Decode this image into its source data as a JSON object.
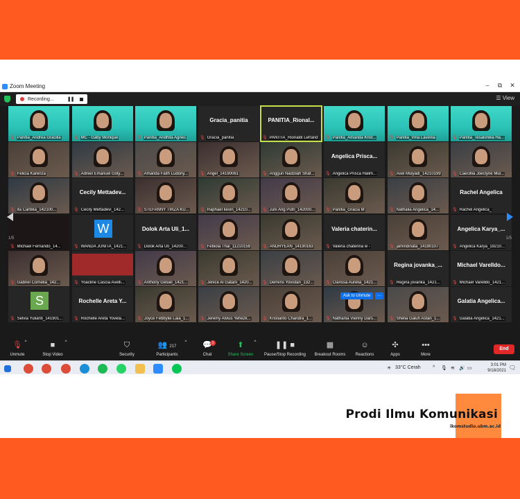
{
  "brand": {
    "title": "Prodi Ilmu Komunikasi",
    "url": "ikomstudio.ubm.ac.id"
  },
  "window": {
    "title": "Zoom Meeting",
    "minimize": "–",
    "maximize": "⧉",
    "close": "✕"
  },
  "topbar": {
    "recording_label": "Recording...",
    "view_label": "View"
  },
  "overlay": {
    "ask_to_unmute": "Ask to Unmute",
    "more": "···"
  },
  "pagination": {
    "left": "1/5",
    "right": "1/5"
  },
  "participants": [
    [
      {
        "name": "Panitia_Andrea Gracilia",
        "big": ""
      },
      {
        "name": "MC - Gaby Monique",
        "big": ""
      },
      {
        "name": "Panitia_Andhita Agnes",
        "big": ""
      },
      {
        "name": "Gracia_panitia",
        "big": "Gracia_panitia"
      },
      {
        "name": "PANITIA_Rionaldi Lefrand",
        "big": "PANITIA_Rional..."
      },
      {
        "name": "Panitia_Amanda Krist...",
        "big": ""
      },
      {
        "name": "Panitia_Vina Lavenia",
        "big": ""
      },
      {
        "name": "Panitia_Tesalonika Ha...",
        "big": ""
      }
    ],
    [
      {
        "name": "Felicia Karenza",
        "big": ""
      },
      {
        "name": "Adreel Emanuel Goly...",
        "big": ""
      },
      {
        "name": "Amanda Faith Ludony...",
        "big": ""
      },
      {
        "name": "Angel_14190061",
        "big": ""
      },
      {
        "name": "Anggun Nadzilah Shaf...",
        "big": ""
      },
      {
        "name": "Angelica Prisca Halim...",
        "big": "Angelica Prisca..."
      },
      {
        "name": "Axel Mulyadi_14210199",
        "big": ""
      },
      {
        "name": "Caecillia Joeclyne Mul...",
        "big": ""
      }
    ],
    [
      {
        "name": "ita Cantika_142100...",
        "big": ""
      },
      {
        "name": "Cecily Mettadevi_142...",
        "big": "Cecily Mettadev..."
      },
      {
        "name": "STEFANNY TIRZA KU...",
        "big": ""
      },
      {
        "name": "Raphael kevin_14210...",
        "big": ""
      },
      {
        "name": "Juni Ang Putri_142000...",
        "big": ""
      },
      {
        "name": "Panitia_Gracia M",
        "big": ""
      },
      {
        "name": "Nathalia Angelica_14...",
        "big": ""
      },
      {
        "name": "Rachel Angelica_",
        "big": "Rachel Angelica"
      }
    ],
    [
      {
        "name": "Michael Fernando_14...",
        "big": ""
      },
      {
        "name": "WANDA JUNITA_1421...",
        "big": ""
      },
      {
        "name": "Dolok Arta Uli_14200...",
        "big": "Dolok Arta Uli_1..."
      },
      {
        "name": "Febiola Thai_11210159",
        "big": ""
      },
      {
        "name": "ANDRYEAN_14190163",
        "big": ""
      },
      {
        "name": "Valeria chaterina w -",
        "big": "Valeria chaterin..."
      },
      {
        "name": "jamindinata_14190107",
        "big": ""
      },
      {
        "name": "Angelica Karya_19210...",
        "big": "Angelica Karya_..."
      }
    ],
    [
      {
        "name": "Gabriel Cornelia_142...",
        "big": ""
      },
      {
        "name": "Yoacline Cascia Avelli...",
        "big": ""
      },
      {
        "name": "Anthony Geluel_1421...",
        "big": ""
      },
      {
        "name": "Jenice Al Gatani_1420...",
        "big": ""
      },
      {
        "name": "Derrens Yovistan_132...",
        "big": ""
      },
      {
        "name": "Clarissa Aurelia_1421...",
        "big": ""
      },
      {
        "name": "Regina jovanka_1421...",
        "big": "Regina jovanka_..."
      },
      {
        "name": "Michael Varelldo_1421...",
        "big": "Michael Varelldo..."
      }
    ],
    [
      {
        "name": "Selvia Yulianti_141901...",
        "big": ""
      },
      {
        "name": "Rochelle Areta Yovela...",
        "big": "Rochelle Areta Y..."
      },
      {
        "name": "Joyce Febbylie Laia_1...",
        "big": ""
      },
      {
        "name": "Jeremy Alvius Yehezk...",
        "big": ""
      },
      {
        "name": "Kristianto Chandra_1...",
        "big": ""
      },
      {
        "name": "Nathania Vienny Dars...",
        "big": ""
      },
      {
        "name": "Shelia Galuh Astari_1...",
        "big": ""
      },
      {
        "name": "Galatia Angelica_1421...",
        "big": "Galatia Angelica..."
      }
    ]
  ],
  "toolbar": {
    "unmute": "Unmute",
    "stop_video": "Stop Video",
    "security": "Security",
    "participants": "Participants",
    "participants_count": "217",
    "chat": "Chat",
    "chat_badge": "1",
    "share_screen": "Share Screen",
    "pause_recording": "Pause/Stop Recording",
    "breakout": "Breakout Rooms",
    "reactions": "Reactions",
    "apps": "Apps",
    "more": "More",
    "end": "End"
  },
  "taskbar": {
    "weather": "33°C  Cerah",
    "time": "3:01 PM",
    "date": "9/18/2021",
    "notif": "3"
  }
}
